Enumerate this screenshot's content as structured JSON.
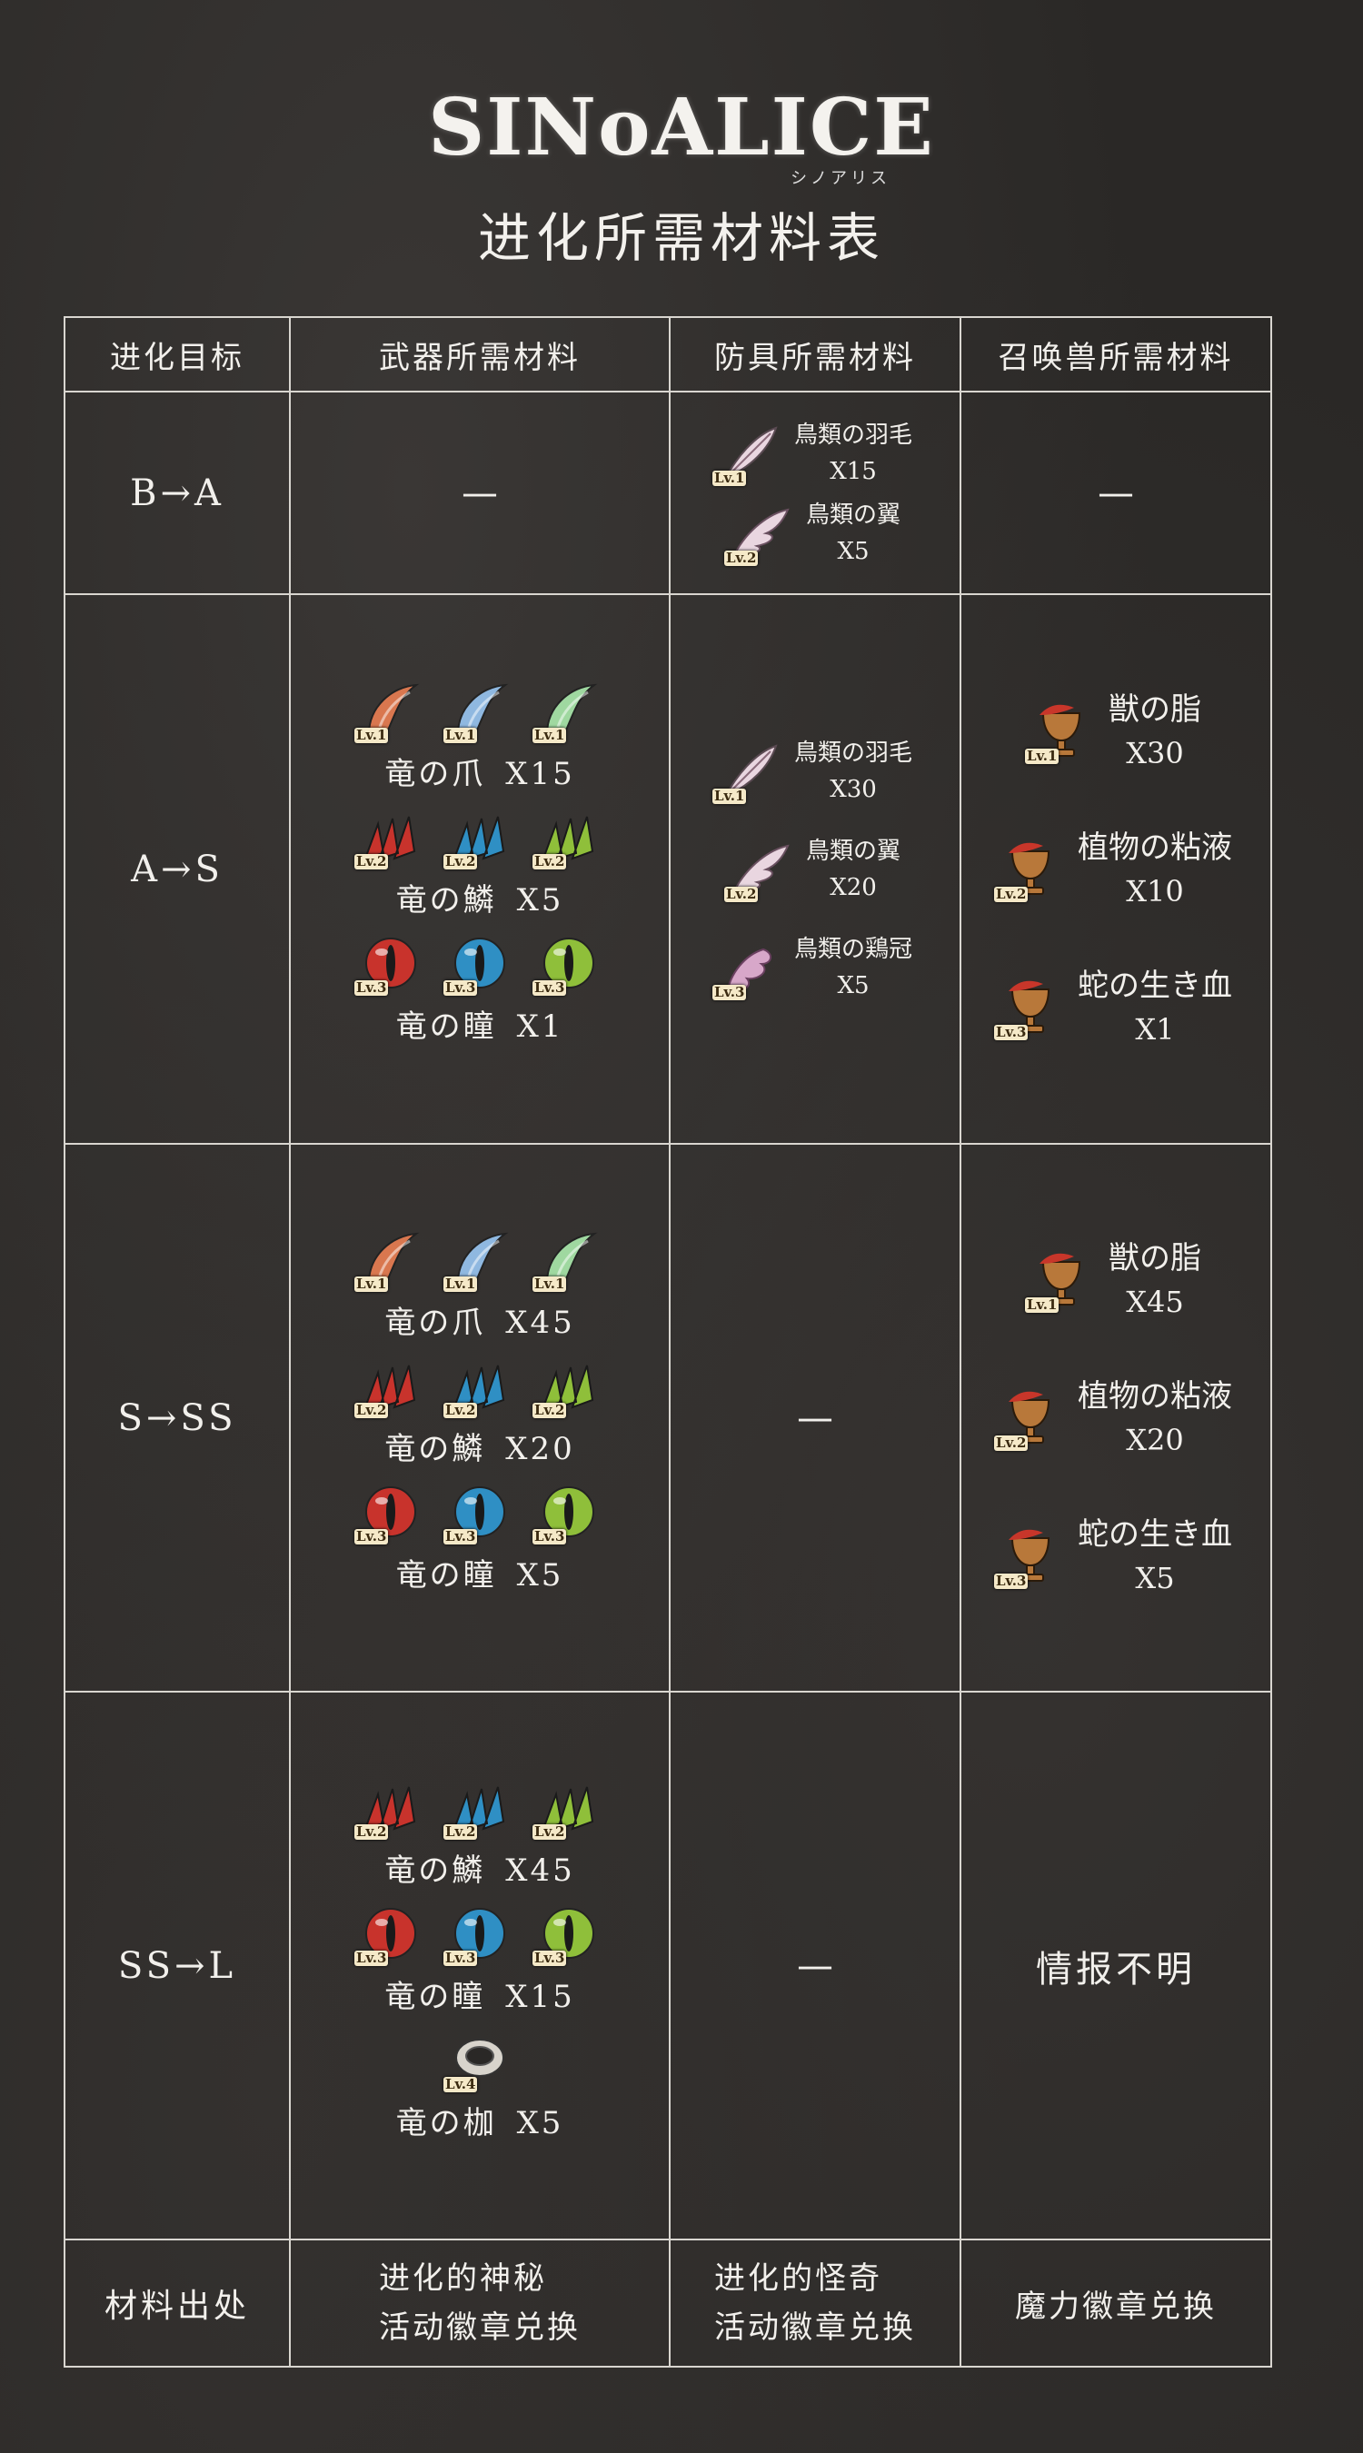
{
  "logo": {
    "text": "SINoALICE",
    "sub": "シノアリス"
  },
  "title": "进化所需材料表",
  "headers": [
    "进化目标",
    "武器所需材料",
    "防具所需材料",
    "召唤兽所需材料"
  ],
  "dash": "—",
  "rows": {
    "b_a": {
      "label": "B→A",
      "armor": [
        {
          "name": "鳥類の羽毛",
          "qty": "X15",
          "lv": "Lv.1",
          "icon": "feather-icon"
        },
        {
          "name": "鳥類の翼",
          "qty": "X5",
          "lv": "Lv.2",
          "icon": "wing-icon"
        }
      ]
    },
    "a_s": {
      "label": "A→S",
      "weapon": [
        {
          "name": "竜の爪",
          "qty": "X15",
          "lv": "Lv.1",
          "icon": "claw-icon"
        },
        {
          "name": "竜の鱗",
          "qty": "X5",
          "lv": "Lv.2",
          "icon": "scale-icon"
        },
        {
          "name": "竜の瞳",
          "qty": "X1",
          "lv": "Lv.3",
          "icon": "eye-orb-icon"
        }
      ],
      "armor": [
        {
          "name": "鳥類の羽毛",
          "qty": "X30",
          "lv": "Lv.1",
          "icon": "feather-icon"
        },
        {
          "name": "鳥類の翼",
          "qty": "X20",
          "lv": "Lv.2",
          "icon": "wing-icon"
        },
        {
          "name": "鳥類の鶏冠",
          "qty": "X5",
          "lv": "Lv.3",
          "icon": "crest-icon"
        }
      ],
      "summon": [
        {
          "name": "獣の脂",
          "qty": "X30",
          "lv": "Lv.1",
          "icon": "chalice-icon"
        },
        {
          "name": "植物の粘液",
          "qty": "X10",
          "lv": "Lv.2",
          "icon": "chalice-icon"
        },
        {
          "name": "蛇の生き血",
          "qty": "X1",
          "lv": "Lv.3",
          "icon": "chalice-icon"
        }
      ]
    },
    "s_ss": {
      "label": "S→SS",
      "weapon": [
        {
          "name": "竜の爪",
          "qty": "X45",
          "lv": "Lv.1",
          "icon": "claw-icon"
        },
        {
          "name": "竜の鱗",
          "qty": "X20",
          "lv": "Lv.2",
          "icon": "scale-icon"
        },
        {
          "name": "竜の瞳",
          "qty": "X5",
          "lv": "Lv.3",
          "icon": "eye-orb-icon"
        }
      ],
      "summon": [
        {
          "name": "獣の脂",
          "qty": "X45",
          "lv": "Lv.1",
          "icon": "chalice-icon"
        },
        {
          "name": "植物の粘液",
          "qty": "X20",
          "lv": "Lv.2",
          "icon": "chalice-icon"
        },
        {
          "name": "蛇の生き血",
          "qty": "X5",
          "lv": "Lv.3",
          "icon": "chalice-icon"
        }
      ]
    },
    "ss_l": {
      "label": "SS→L",
      "weapon": [
        {
          "name": "竜の鱗",
          "qty": "X45",
          "lv": "Lv.2",
          "icon": "scale-icon"
        },
        {
          "name": "竜の瞳",
          "qty": "X15",
          "lv": "Lv.3",
          "icon": "eye-orb-icon"
        },
        {
          "name": "竜の枷",
          "qty": "X5",
          "lv": "Lv.4",
          "icon": "shackle-icon"
        }
      ],
      "summon_text": "情报不明"
    }
  },
  "source": {
    "label": "材料出处",
    "weapon_line1": "进化的神秘",
    "weapon_line2": "活动徽章兑换",
    "armor_line1": "进化的怪奇",
    "armor_line2": "活动徽章兑换",
    "summon": "魔力徽章兑换"
  },
  "colors": {
    "red": "#c8332c",
    "blue": "#2f8fc4",
    "green": "#8fbf3a",
    "claw_red": "#d9774f",
    "claw_blue": "#8fb8e0",
    "claw_green": "#9fd8a0",
    "feather": "#e9d6e0",
    "chalice": "#b8783a"
  }
}
